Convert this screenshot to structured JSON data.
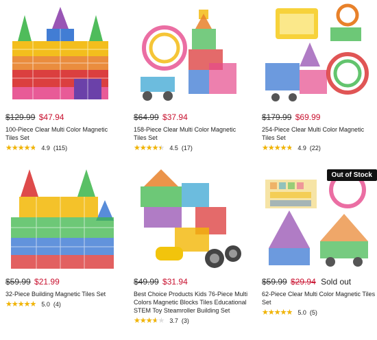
{
  "products": [
    {
      "old_price": "$129.99",
      "new_price": "$47.94",
      "title": "100-Piece Clear Multi Color Magnetic Tiles Set",
      "rating_text": "4.9",
      "rating": 4.9,
      "count": "(115)"
    },
    {
      "old_price": "$64.99",
      "new_price": "$37.94",
      "title": "158-Piece Clear Multi Color Magnetic Tiles Set",
      "rating_text": "4.5",
      "rating": 4.5,
      "count": "(17)"
    },
    {
      "old_price": "$179.99",
      "new_price": "$69.99",
      "title": "254-Piece Clear Multi Color Magnetic Tiles Set",
      "rating_text": "4.9",
      "rating": 4.9,
      "count": "(22)"
    },
    {
      "old_price": "$59.99",
      "new_price": "$21.99",
      "title": "32-Piece Building Magnetic Tiles Set",
      "rating_text": "5.0",
      "rating": 5.0,
      "count": "(4)"
    },
    {
      "old_price": "$49.99",
      "new_price": "$31.94",
      "title": "Best Choice Products Kids 76-Piece Multi Colors Magnetic Blocks Tiles Educational STEM Toy Steamroller Building Set",
      "rating_text": "3.7",
      "rating": 3.7,
      "count": "(3)"
    },
    {
      "old_price": "$59.99",
      "sale_price": "$29.94",
      "sold_label": "Sold out",
      "badge": "Out of Stock",
      "title": "62-Piece Clear Multi Color Magnetic Tiles Set",
      "rating_text": "5.0",
      "rating": 5.0,
      "count": "(5)"
    }
  ],
  "colors": {
    "sale_red": "#c8102e",
    "star": "#f2b400",
    "badge_bg": "#111111"
  },
  "icons": {
    "star": "star-icon"
  }
}
